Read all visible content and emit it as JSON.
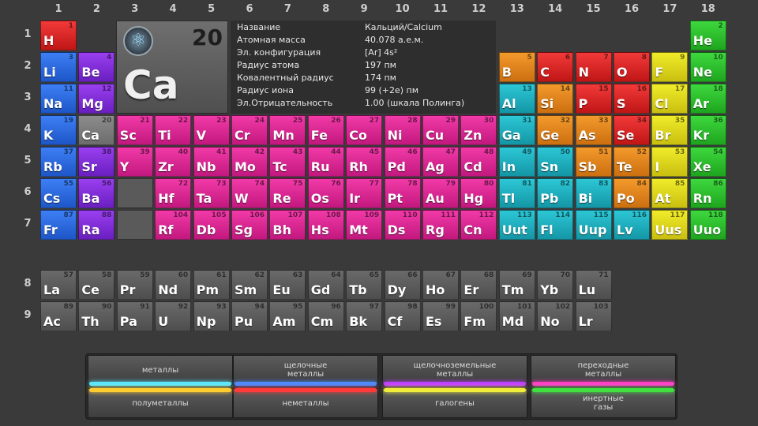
{
  "group_numbers": [
    "1",
    "2",
    "3",
    "4",
    "5",
    "6",
    "7",
    "8",
    "9",
    "10",
    "11",
    "12",
    "13",
    "14",
    "15",
    "16",
    "17",
    "18"
  ],
  "period_numbers": [
    "1",
    "2",
    "3",
    "4",
    "5",
    "6",
    "7"
  ],
  "series_period_numbers": [
    "8",
    "9"
  ],
  "selected": {
    "number": "20",
    "symbol": "Ca",
    "icon": "atom-icon",
    "info": [
      {
        "k": "Название",
        "v": "Кальций/Calcium"
      },
      {
        "k": "Атомная масса",
        "v": "40.078 а.е.м."
      },
      {
        "k": "Эл. конфигурация",
        "v": "[Ar] 4s²"
      },
      {
        "k": "Радиус атома",
        "v": "197 пм"
      },
      {
        "k": "Ковалентный радиус",
        "v": "174 пм"
      },
      {
        "k": "Радиус иона",
        "v": "99 (+2e) пм"
      },
      {
        "k": "Эл.Отрицательность",
        "v": "1.00 (шкала Полинга)"
      }
    ]
  },
  "colors": {
    "alkali": "#2f6fe8",
    "alkearth": "#8530e0",
    "trans": "#e02596",
    "post": "#20b4c4",
    "metalloid": "#e6841e",
    "nonmetal": "#e02828",
    "halogen": "#e6dc1e",
    "noble": "#2ec02e",
    "lanact": "#5c5c5c"
  },
  "elements": [
    {
      "n": "1",
      "s": "H",
      "g": 1,
      "p": 1,
      "c": "nonmetal"
    },
    {
      "n": "2",
      "s": "He",
      "g": 18,
      "p": 1,
      "c": "noble"
    },
    {
      "n": "3",
      "s": "Li",
      "g": 1,
      "p": 2,
      "c": "alkali"
    },
    {
      "n": "4",
      "s": "Be",
      "g": 2,
      "p": 2,
      "c": "alkearth"
    },
    {
      "n": "5",
      "s": "B",
      "g": 13,
      "p": 2,
      "c": "metalloid"
    },
    {
      "n": "6",
      "s": "C",
      "g": 14,
      "p": 2,
      "c": "nonmetal"
    },
    {
      "n": "7",
      "s": "N",
      "g": 15,
      "p": 2,
      "c": "nonmetal"
    },
    {
      "n": "8",
      "s": "O",
      "g": 16,
      "p": 2,
      "c": "nonmetal"
    },
    {
      "n": "9",
      "s": "F",
      "g": 17,
      "p": 2,
      "c": "halogen"
    },
    {
      "n": "10",
      "s": "Ne",
      "g": 18,
      "p": 2,
      "c": "noble"
    },
    {
      "n": "11",
      "s": "Na",
      "g": 1,
      "p": 3,
      "c": "alkali"
    },
    {
      "n": "12",
      "s": "Mg",
      "g": 2,
      "p": 3,
      "c": "alkearth"
    },
    {
      "n": "13",
      "s": "Al",
      "g": 13,
      "p": 3,
      "c": "post"
    },
    {
      "n": "14",
      "s": "Si",
      "g": 14,
      "p": 3,
      "c": "metalloid"
    },
    {
      "n": "15",
      "s": "P",
      "g": 15,
      "p": 3,
      "c": "nonmetal"
    },
    {
      "n": "16",
      "s": "S",
      "g": 16,
      "p": 3,
      "c": "nonmetal"
    },
    {
      "n": "17",
      "s": "Cl",
      "g": 17,
      "p": 3,
      "c": "halogen"
    },
    {
      "n": "18",
      "s": "Ar",
      "g": 18,
      "p": 3,
      "c": "noble"
    },
    {
      "n": "19",
      "s": "K",
      "g": 1,
      "p": 4,
      "c": "alkali"
    },
    {
      "n": "20",
      "s": "Ca",
      "g": 2,
      "p": 4,
      "c": "selected"
    },
    {
      "n": "21",
      "s": "Sc",
      "g": 3,
      "p": 4,
      "c": "trans"
    },
    {
      "n": "22",
      "s": "Ti",
      "g": 4,
      "p": 4,
      "c": "trans"
    },
    {
      "n": "23",
      "s": "V",
      "g": 5,
      "p": 4,
      "c": "trans"
    },
    {
      "n": "24",
      "s": "Cr",
      "g": 6,
      "p": 4,
      "c": "trans"
    },
    {
      "n": "25",
      "s": "Mn",
      "g": 7,
      "p": 4,
      "c": "trans"
    },
    {
      "n": "26",
      "s": "Fe",
      "g": 8,
      "p": 4,
      "c": "trans"
    },
    {
      "n": "27",
      "s": "Co",
      "g": 9,
      "p": 4,
      "c": "trans"
    },
    {
      "n": "28",
      "s": "Ni",
      "g": 10,
      "p": 4,
      "c": "trans"
    },
    {
      "n": "29",
      "s": "Cu",
      "g": 11,
      "p": 4,
      "c": "trans"
    },
    {
      "n": "30",
      "s": "Zn",
      "g": 12,
      "p": 4,
      "c": "trans"
    },
    {
      "n": "31",
      "s": "Ga",
      "g": 13,
      "p": 4,
      "c": "post"
    },
    {
      "n": "32",
      "s": "Ge",
      "g": 14,
      "p": 4,
      "c": "metalloid"
    },
    {
      "n": "33",
      "s": "As",
      "g": 15,
      "p": 4,
      "c": "metalloid"
    },
    {
      "n": "34",
      "s": "Se",
      "g": 16,
      "p": 4,
      "c": "nonmetal"
    },
    {
      "n": "35",
      "s": "Br",
      "g": 17,
      "p": 4,
      "c": "halogen"
    },
    {
      "n": "36",
      "s": "Kr",
      "g": 18,
      "p": 4,
      "c": "noble"
    },
    {
      "n": "37",
      "s": "Rb",
      "g": 1,
      "p": 5,
      "c": "alkali"
    },
    {
      "n": "38",
      "s": "Sr",
      "g": 2,
      "p": 5,
      "c": "alkearth"
    },
    {
      "n": "39",
      "s": "Y",
      "g": 3,
      "p": 5,
      "c": "trans"
    },
    {
      "n": "40",
      "s": "Zr",
      "g": 4,
      "p": 5,
      "c": "trans"
    },
    {
      "n": "41",
      "s": "Nb",
      "g": 5,
      "p": 5,
      "c": "trans"
    },
    {
      "n": "42",
      "s": "Mo",
      "g": 6,
      "p": 5,
      "c": "trans"
    },
    {
      "n": "43",
      "s": "Tc",
      "g": 7,
      "p": 5,
      "c": "trans"
    },
    {
      "n": "44",
      "s": "Ru",
      "g": 8,
      "p": 5,
      "c": "trans"
    },
    {
      "n": "45",
      "s": "Rh",
      "g": 9,
      "p": 5,
      "c": "trans"
    },
    {
      "n": "46",
      "s": "Pd",
      "g": 10,
      "p": 5,
      "c": "trans"
    },
    {
      "n": "47",
      "s": "Ag",
      "g": 11,
      "p": 5,
      "c": "trans"
    },
    {
      "n": "48",
      "s": "Cd",
      "g": 12,
      "p": 5,
      "c": "trans"
    },
    {
      "n": "49",
      "s": "In",
      "g": 13,
      "p": 5,
      "c": "post"
    },
    {
      "n": "50",
      "s": "Sn",
      "g": 14,
      "p": 5,
      "c": "post"
    },
    {
      "n": "51",
      "s": "Sb",
      "g": 15,
      "p": 5,
      "c": "metalloid"
    },
    {
      "n": "52",
      "s": "Te",
      "g": 16,
      "p": 5,
      "c": "metalloid"
    },
    {
      "n": "53",
      "s": "I",
      "g": 17,
      "p": 5,
      "c": "halogen"
    },
    {
      "n": "54",
      "s": "Xe",
      "g": 18,
      "p": 5,
      "c": "noble"
    },
    {
      "n": "55",
      "s": "Cs",
      "g": 1,
      "p": 6,
      "c": "alkali"
    },
    {
      "n": "56",
      "s": "Ba",
      "g": 2,
      "p": 6,
      "c": "alkearth"
    },
    {
      "n": "72",
      "s": "Hf",
      "g": 4,
      "p": 6,
      "c": "trans"
    },
    {
      "n": "73",
      "s": "Ta",
      "g": 5,
      "p": 6,
      "c": "trans"
    },
    {
      "n": "74",
      "s": "W",
      "g": 6,
      "p": 6,
      "c": "trans"
    },
    {
      "n": "75",
      "s": "Re",
      "g": 7,
      "p": 6,
      "c": "trans"
    },
    {
      "n": "76",
      "s": "Os",
      "g": 8,
      "p": 6,
      "c": "trans"
    },
    {
      "n": "77",
      "s": "Ir",
      "g": 9,
      "p": 6,
      "c": "trans"
    },
    {
      "n": "78",
      "s": "Pt",
      "g": 10,
      "p": 6,
      "c": "trans"
    },
    {
      "n": "79",
      "s": "Au",
      "g": 11,
      "p": 6,
      "c": "trans"
    },
    {
      "n": "80",
      "s": "Hg",
      "g": 12,
      "p": 6,
      "c": "trans"
    },
    {
      "n": "81",
      "s": "Tl",
      "g": 13,
      "p": 6,
      "c": "post"
    },
    {
      "n": "82",
      "s": "Pb",
      "g": 14,
      "p": 6,
      "c": "post"
    },
    {
      "n": "83",
      "s": "Bi",
      "g": 15,
      "p": 6,
      "c": "post"
    },
    {
      "n": "84",
      "s": "Po",
      "g": 16,
      "p": 6,
      "c": "metalloid"
    },
    {
      "n": "85",
      "s": "At",
      "g": 17,
      "p": 6,
      "c": "halogen"
    },
    {
      "n": "86",
      "s": "Rn",
      "g": 18,
      "p": 6,
      "c": "noble"
    },
    {
      "n": "87",
      "s": "Fr",
      "g": 1,
      "p": 7,
      "c": "alkali"
    },
    {
      "n": "88",
      "s": "Ra",
      "g": 2,
      "p": 7,
      "c": "alkearth"
    },
    {
      "n": "104",
      "s": "Rf",
      "g": 4,
      "p": 7,
      "c": "trans"
    },
    {
      "n": "105",
      "s": "Db",
      "g": 5,
      "p": 7,
      "c": "trans"
    },
    {
      "n": "106",
      "s": "Sg",
      "g": 6,
      "p": 7,
      "c": "trans"
    },
    {
      "n": "107",
      "s": "Bh",
      "g": 7,
      "p": 7,
      "c": "trans"
    },
    {
      "n": "108",
      "s": "Hs",
      "g": 8,
      "p": 7,
      "c": "trans"
    },
    {
      "n": "109",
      "s": "Mt",
      "g": 9,
      "p": 7,
      "c": "trans"
    },
    {
      "n": "110",
      "s": "Ds",
      "g": 10,
      "p": 7,
      "c": "trans"
    },
    {
      "n": "111",
      "s": "Rg",
      "g": 11,
      "p": 7,
      "c": "trans"
    },
    {
      "n": "112",
      "s": "Cn",
      "g": 12,
      "p": 7,
      "c": "trans"
    },
    {
      "n": "113",
      "s": "Uut",
      "g": 13,
      "p": 7,
      "c": "post"
    },
    {
      "n": "114",
      "s": "Fl",
      "g": 14,
      "p": 7,
      "c": "post"
    },
    {
      "n": "115",
      "s": "Uup",
      "g": 15,
      "p": 7,
      "c": "post"
    },
    {
      "n": "116",
      "s": "Lv",
      "g": 16,
      "p": 7,
      "c": "post"
    },
    {
      "n": "117",
      "s": "Uus",
      "g": 17,
      "p": 7,
      "c": "halogen"
    },
    {
      "n": "118",
      "s": "Uuo",
      "g": 18,
      "p": 7,
      "c": "noble"
    }
  ],
  "lanthanides": [
    {
      "n": "57",
      "s": "La"
    },
    {
      "n": "58",
      "s": "Ce"
    },
    {
      "n": "59",
      "s": "Pr"
    },
    {
      "n": "60",
      "s": "Nd"
    },
    {
      "n": "61",
      "s": "Pm"
    },
    {
      "n": "62",
      "s": "Sm"
    },
    {
      "n": "63",
      "s": "Eu"
    },
    {
      "n": "64",
      "s": "Gd"
    },
    {
      "n": "65",
      "s": "Tb"
    },
    {
      "n": "66",
      "s": "Dy"
    },
    {
      "n": "67",
      "s": "Ho"
    },
    {
      "n": "68",
      "s": "Er"
    },
    {
      "n": "69",
      "s": "Tm"
    },
    {
      "n": "70",
      "s": "Yb"
    },
    {
      "n": "71",
      "s": "Lu"
    }
  ],
  "actinides": [
    {
      "n": "89",
      "s": "Ac"
    },
    {
      "n": "90",
      "s": "Th"
    },
    {
      "n": "91",
      "s": "Pa"
    },
    {
      "n": "92",
      "s": "U"
    },
    {
      "n": "93",
      "s": "Np"
    },
    {
      "n": "94",
      "s": "Pu"
    },
    {
      "n": "95",
      "s": "Am"
    },
    {
      "n": "96",
      "s": "Cm"
    },
    {
      "n": "97",
      "s": "Bk"
    },
    {
      "n": "98",
      "s": "Cf"
    },
    {
      "n": "99",
      "s": "Es"
    },
    {
      "n": "100",
      "s": "Fm"
    },
    {
      "n": "101",
      "s": "Md"
    },
    {
      "n": "102",
      "s": "No"
    },
    {
      "n": "103",
      "s": "Lr"
    }
  ],
  "legend": {
    "top": [
      "металлы",
      "щелочные\nметаллы",
      "щелочноземельные\nметаллы",
      "переходные\nметаллы"
    ],
    "bottom": [
      "полуметаллы",
      "неметаллы",
      "галогены",
      "инертные\nгазы"
    ],
    "glow_top": [
      "#5be7ff",
      "#4d8cff",
      "#c040ff",
      "#ff40c8"
    ],
    "glow_bottom": [
      "#ffcc30",
      "#ff3a3a",
      "#f0ec3a",
      "#40e040"
    ]
  }
}
